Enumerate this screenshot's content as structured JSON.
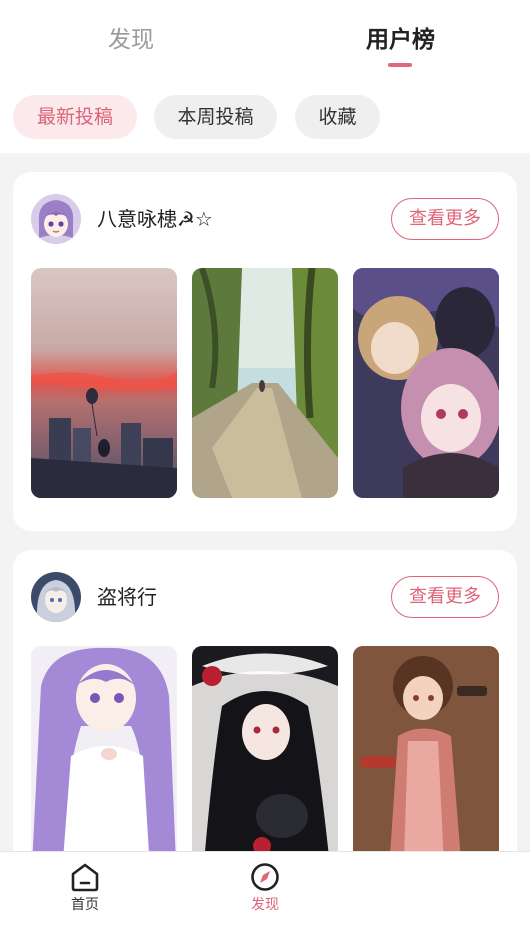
{
  "header": {
    "tabs": [
      {
        "label": "发现",
        "active": false
      },
      {
        "label": "用户榜",
        "active": true
      }
    ],
    "accent_color": "#e0677d"
  },
  "filters": [
    {
      "label": "最新投稿",
      "selected": true
    },
    {
      "label": "本周投稿",
      "selected": false
    },
    {
      "label": "收藏",
      "selected": false
    }
  ],
  "users": [
    {
      "name": "八意咏槵☭☆",
      "more_label": "查看更多",
      "thumbnails": [
        "sunset-city-artwork",
        "forest-road-artwork",
        "anime-girls-group-artwork"
      ]
    },
    {
      "name": "盗将行",
      "more_label": "查看更多",
      "thumbnails": [
        "purple-hair-girl-artwork",
        "black-hair-hat-girl-artwork",
        "gun-girl-artwork"
      ]
    }
  ],
  "bottom_nav": [
    {
      "label": "首页",
      "icon": "home-icon",
      "active": false
    },
    {
      "label": "发现",
      "icon": "compass-icon",
      "active": true
    }
  ]
}
